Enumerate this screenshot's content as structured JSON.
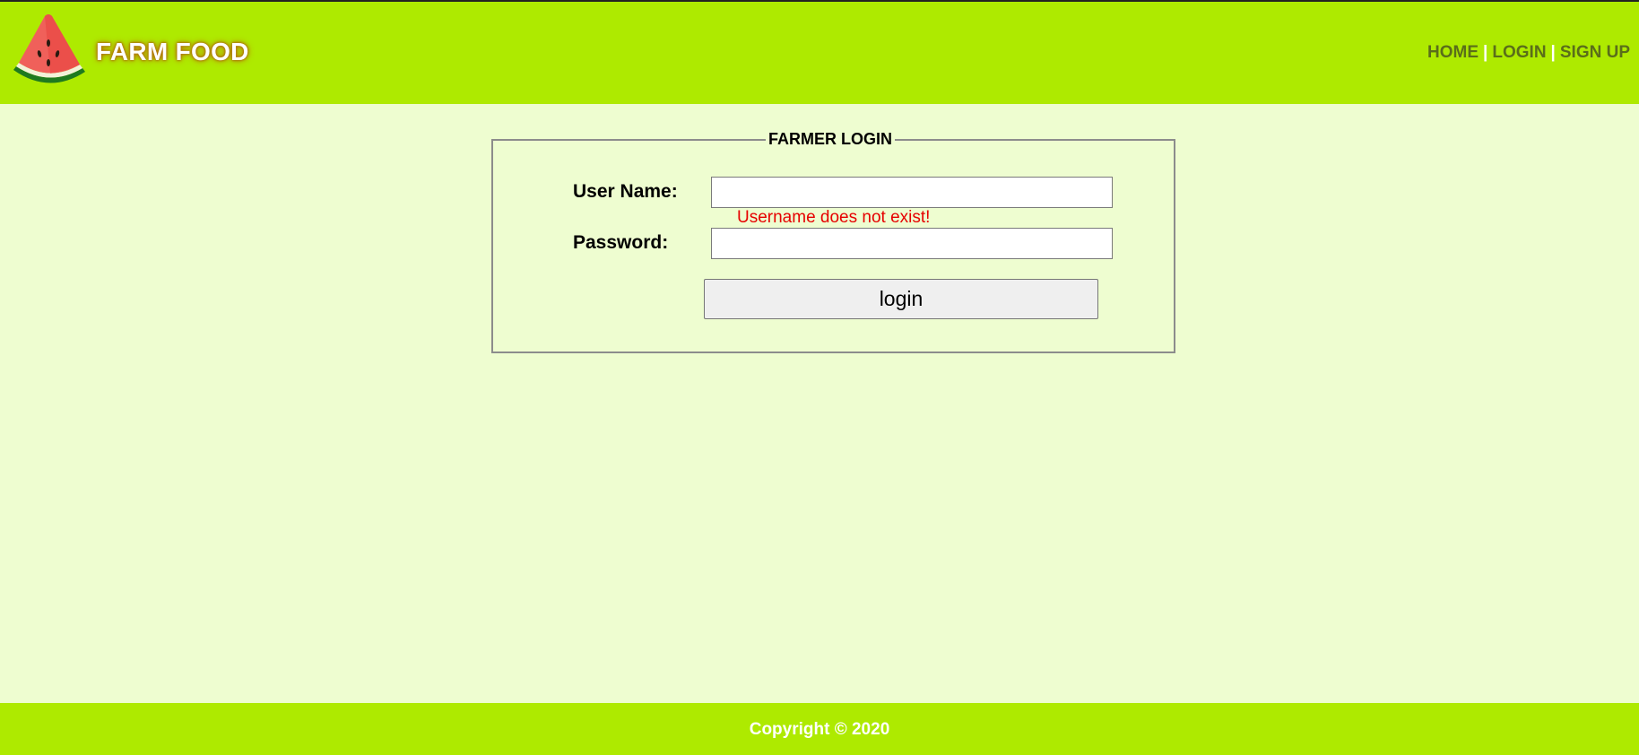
{
  "header": {
    "brand": "FARM FOOD",
    "logo_icon": "watermelon-icon",
    "nav": {
      "home": "HOME",
      "login": "LOGIN",
      "signup": "SIGN UP",
      "separator": "|"
    }
  },
  "login_form": {
    "legend": "FARMER LOGIN",
    "username_label": "User Name:",
    "username_value": "",
    "password_label": "Password:",
    "password_value": "",
    "error_message": "Username does not exist!",
    "submit_label": "login"
  },
  "footer": {
    "copyright": "Copyright © 2020"
  },
  "colors": {
    "header_bg": "#aeea00",
    "page_bg": "#eefdd0",
    "error": "#e60000",
    "nav_link": "#5a6e1a"
  }
}
